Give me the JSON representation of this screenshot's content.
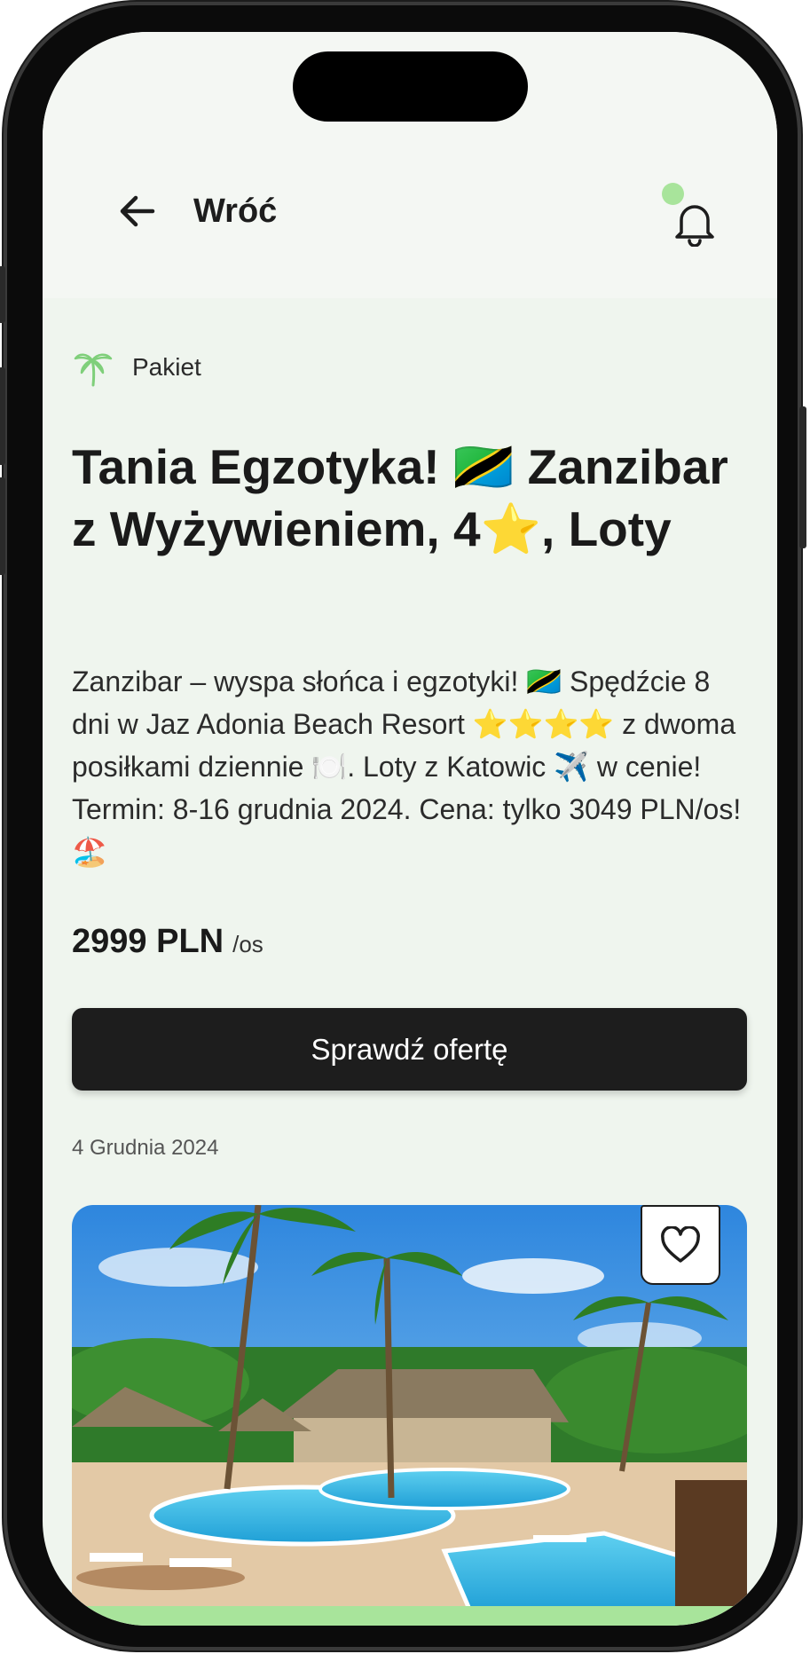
{
  "header": {
    "back_label": "Wróć",
    "back_icon": "arrow-left-icon",
    "notification_icon": "bell-icon",
    "notification_dot_color": "#a8e49b"
  },
  "offer": {
    "category_icon": "palm-tree-icon",
    "category_label": "Pakiet",
    "title": "Tania Egzotyka! 🇹🇿 Zanzibar z Wyżywieniem, 4⭐, Loty",
    "description": "Zanzibar – wyspa słońca i egzotyki! 🇹🇿 Spędźcie 8 dni w Jaz Adonia Beach Resort ⭐⭐⭐⭐ z dwoma posiłkami dziennie 🍽️. Loty z Katowic ✈️ w cenie! Termin: 8-16 grudnia 2024. Cena: tylko 3049 PLN/os! 🏖️",
    "price": "2999 PLN",
    "price_unit": "/os",
    "cta_label": "Sprawdź ofertę",
    "date": "4 Grudnia 2024",
    "favorite_icon": "heart-icon"
  },
  "colors": {
    "accent": "#a8e49b",
    "button": "#1d1d1d",
    "background": "#eff5ee"
  }
}
